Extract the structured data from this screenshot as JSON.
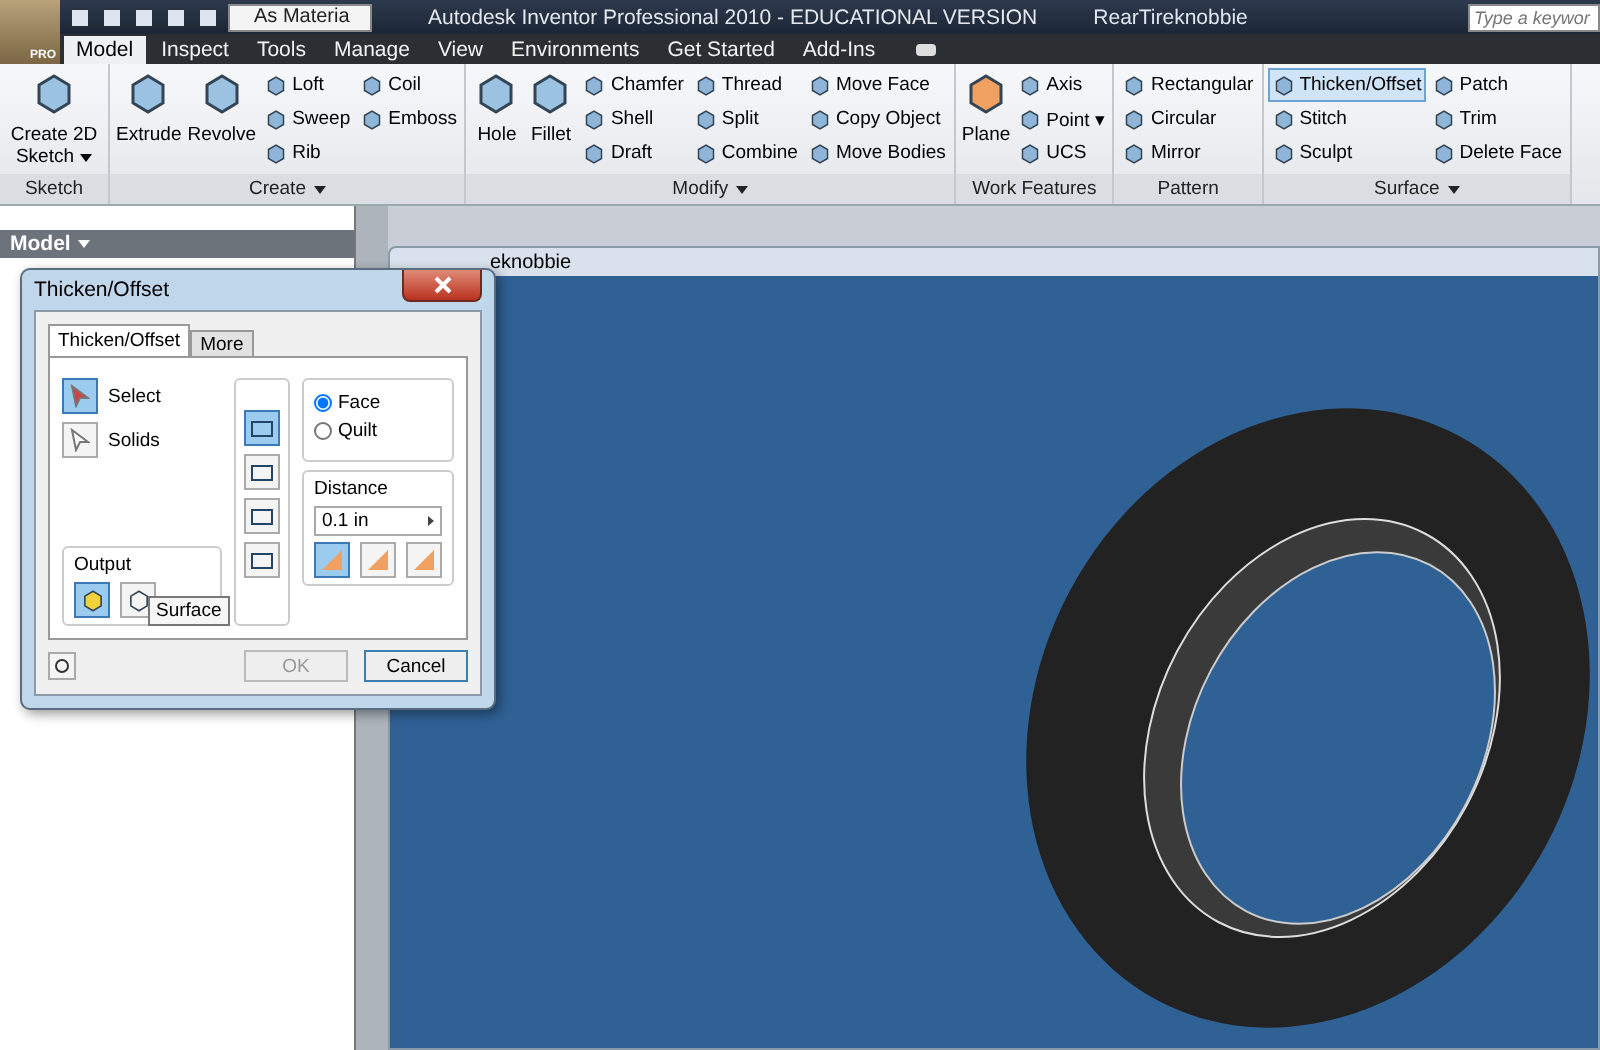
{
  "app_menu": {
    "label": "PRO"
  },
  "quick_access": {
    "material": "As Materia"
  },
  "title_bar": {
    "title": "Autodesk Inventor Professional 2010 - EDUCATIONAL VERSION",
    "document": "RearTireknobbie",
    "search_placeholder": "Type a keywor"
  },
  "tabs": [
    {
      "label": "Model",
      "selected": true
    },
    {
      "label": "Inspect",
      "selected": false
    },
    {
      "label": "Tools",
      "selected": false
    },
    {
      "label": "Manage",
      "selected": false
    },
    {
      "label": "View",
      "selected": false
    },
    {
      "label": "Environments",
      "selected": false
    },
    {
      "label": "Get Started",
      "selected": false
    },
    {
      "label": "Add-Ins",
      "selected": false
    }
  ],
  "ribbon_panels": [
    {
      "title": "Sketch",
      "dropdown": false,
      "large": [
        {
          "label": "Create 2D Sketch",
          "dropdown": true
        }
      ]
    },
    {
      "title": "Create",
      "dropdown": true,
      "large": [
        {
          "label": "Extrude",
          "dropdown": false
        },
        {
          "label": "Revolve",
          "dropdown": false
        }
      ],
      "small": [
        {
          "label": "Loft",
          "selected": false
        },
        {
          "label": "Sweep",
          "selected": false
        },
        {
          "label": "Rib",
          "selected": false
        },
        {
          "label": "Coil",
          "selected": false
        },
        {
          "label": "Emboss",
          "selected": false
        }
      ]
    },
    {
      "title": "Modify",
      "dropdown": true,
      "large": [
        {
          "label": "Hole",
          "dropdown": false
        },
        {
          "label": "Fillet",
          "dropdown": false
        }
      ],
      "small": [
        {
          "label": "Chamfer",
          "selected": false
        },
        {
          "label": "Shell",
          "selected": false
        },
        {
          "label": "Draft",
          "selected": false
        },
        {
          "label": "Thread",
          "selected": false
        },
        {
          "label": "Split",
          "selected": false
        },
        {
          "label": "Combine",
          "selected": false
        },
        {
          "label": "Move Face",
          "selected": false
        },
        {
          "label": "Copy Object",
          "selected": false
        },
        {
          "label": "Move Bodies",
          "selected": false
        }
      ]
    },
    {
      "title": "Work Features",
      "dropdown": false,
      "large": [
        {
          "label": "Plane",
          "dropdown": false
        }
      ],
      "small": [
        {
          "label": "Axis",
          "selected": false
        },
        {
          "label": "Point ▾",
          "selected": false
        },
        {
          "label": "UCS",
          "selected": false
        }
      ]
    },
    {
      "title": "Pattern",
      "dropdown": false,
      "small": [
        {
          "label": "Rectangular",
          "selected": false
        },
        {
          "label": "Circular",
          "selected": false
        },
        {
          "label": "Mirror",
          "selected": false
        }
      ]
    },
    {
      "title": "Surface",
      "dropdown": true,
      "small": [
        {
          "label": "Thicken/Offset",
          "selected": true
        },
        {
          "label": "Stitch",
          "selected": false
        },
        {
          "label": "Sculpt",
          "selected": false
        },
        {
          "label": "Patch",
          "selected": false
        },
        {
          "label": "Trim",
          "selected": false
        },
        {
          "label": "Delete Face",
          "selected": false
        }
      ]
    }
  ],
  "browser": {
    "title": "Model"
  },
  "document": {
    "title": "eknobbie"
  },
  "dialog": {
    "title": "Thicken/Offset",
    "tabs": [
      {
        "label": "Thicken/Offset",
        "selected": true
      },
      {
        "label": "More",
        "selected": false
      }
    ],
    "selectors": [
      {
        "label": "Select",
        "selected": true
      },
      {
        "label": "Solids",
        "selected": false
      }
    ],
    "output": {
      "label": "Output",
      "options": [
        {
          "kind": "solid",
          "selected": true
        },
        {
          "kind": "surface",
          "selected": false
        }
      ],
      "tooltip": "Surface"
    },
    "sides": [
      {
        "selected": true
      },
      {
        "selected": false
      },
      {
        "selected": false
      },
      {
        "selected": false
      }
    ],
    "mode": [
      {
        "label": "Face",
        "selected": true
      },
      {
        "label": "Quilt",
        "selected": false
      }
    ],
    "distance": {
      "label": "Distance",
      "value": "0.1 in"
    },
    "directions": [
      {
        "selected": true
      },
      {
        "selected": false
      },
      {
        "selected": false
      }
    ],
    "ok": {
      "label": "OK",
      "disabled": true
    },
    "cancel": {
      "label": "Cancel"
    }
  }
}
